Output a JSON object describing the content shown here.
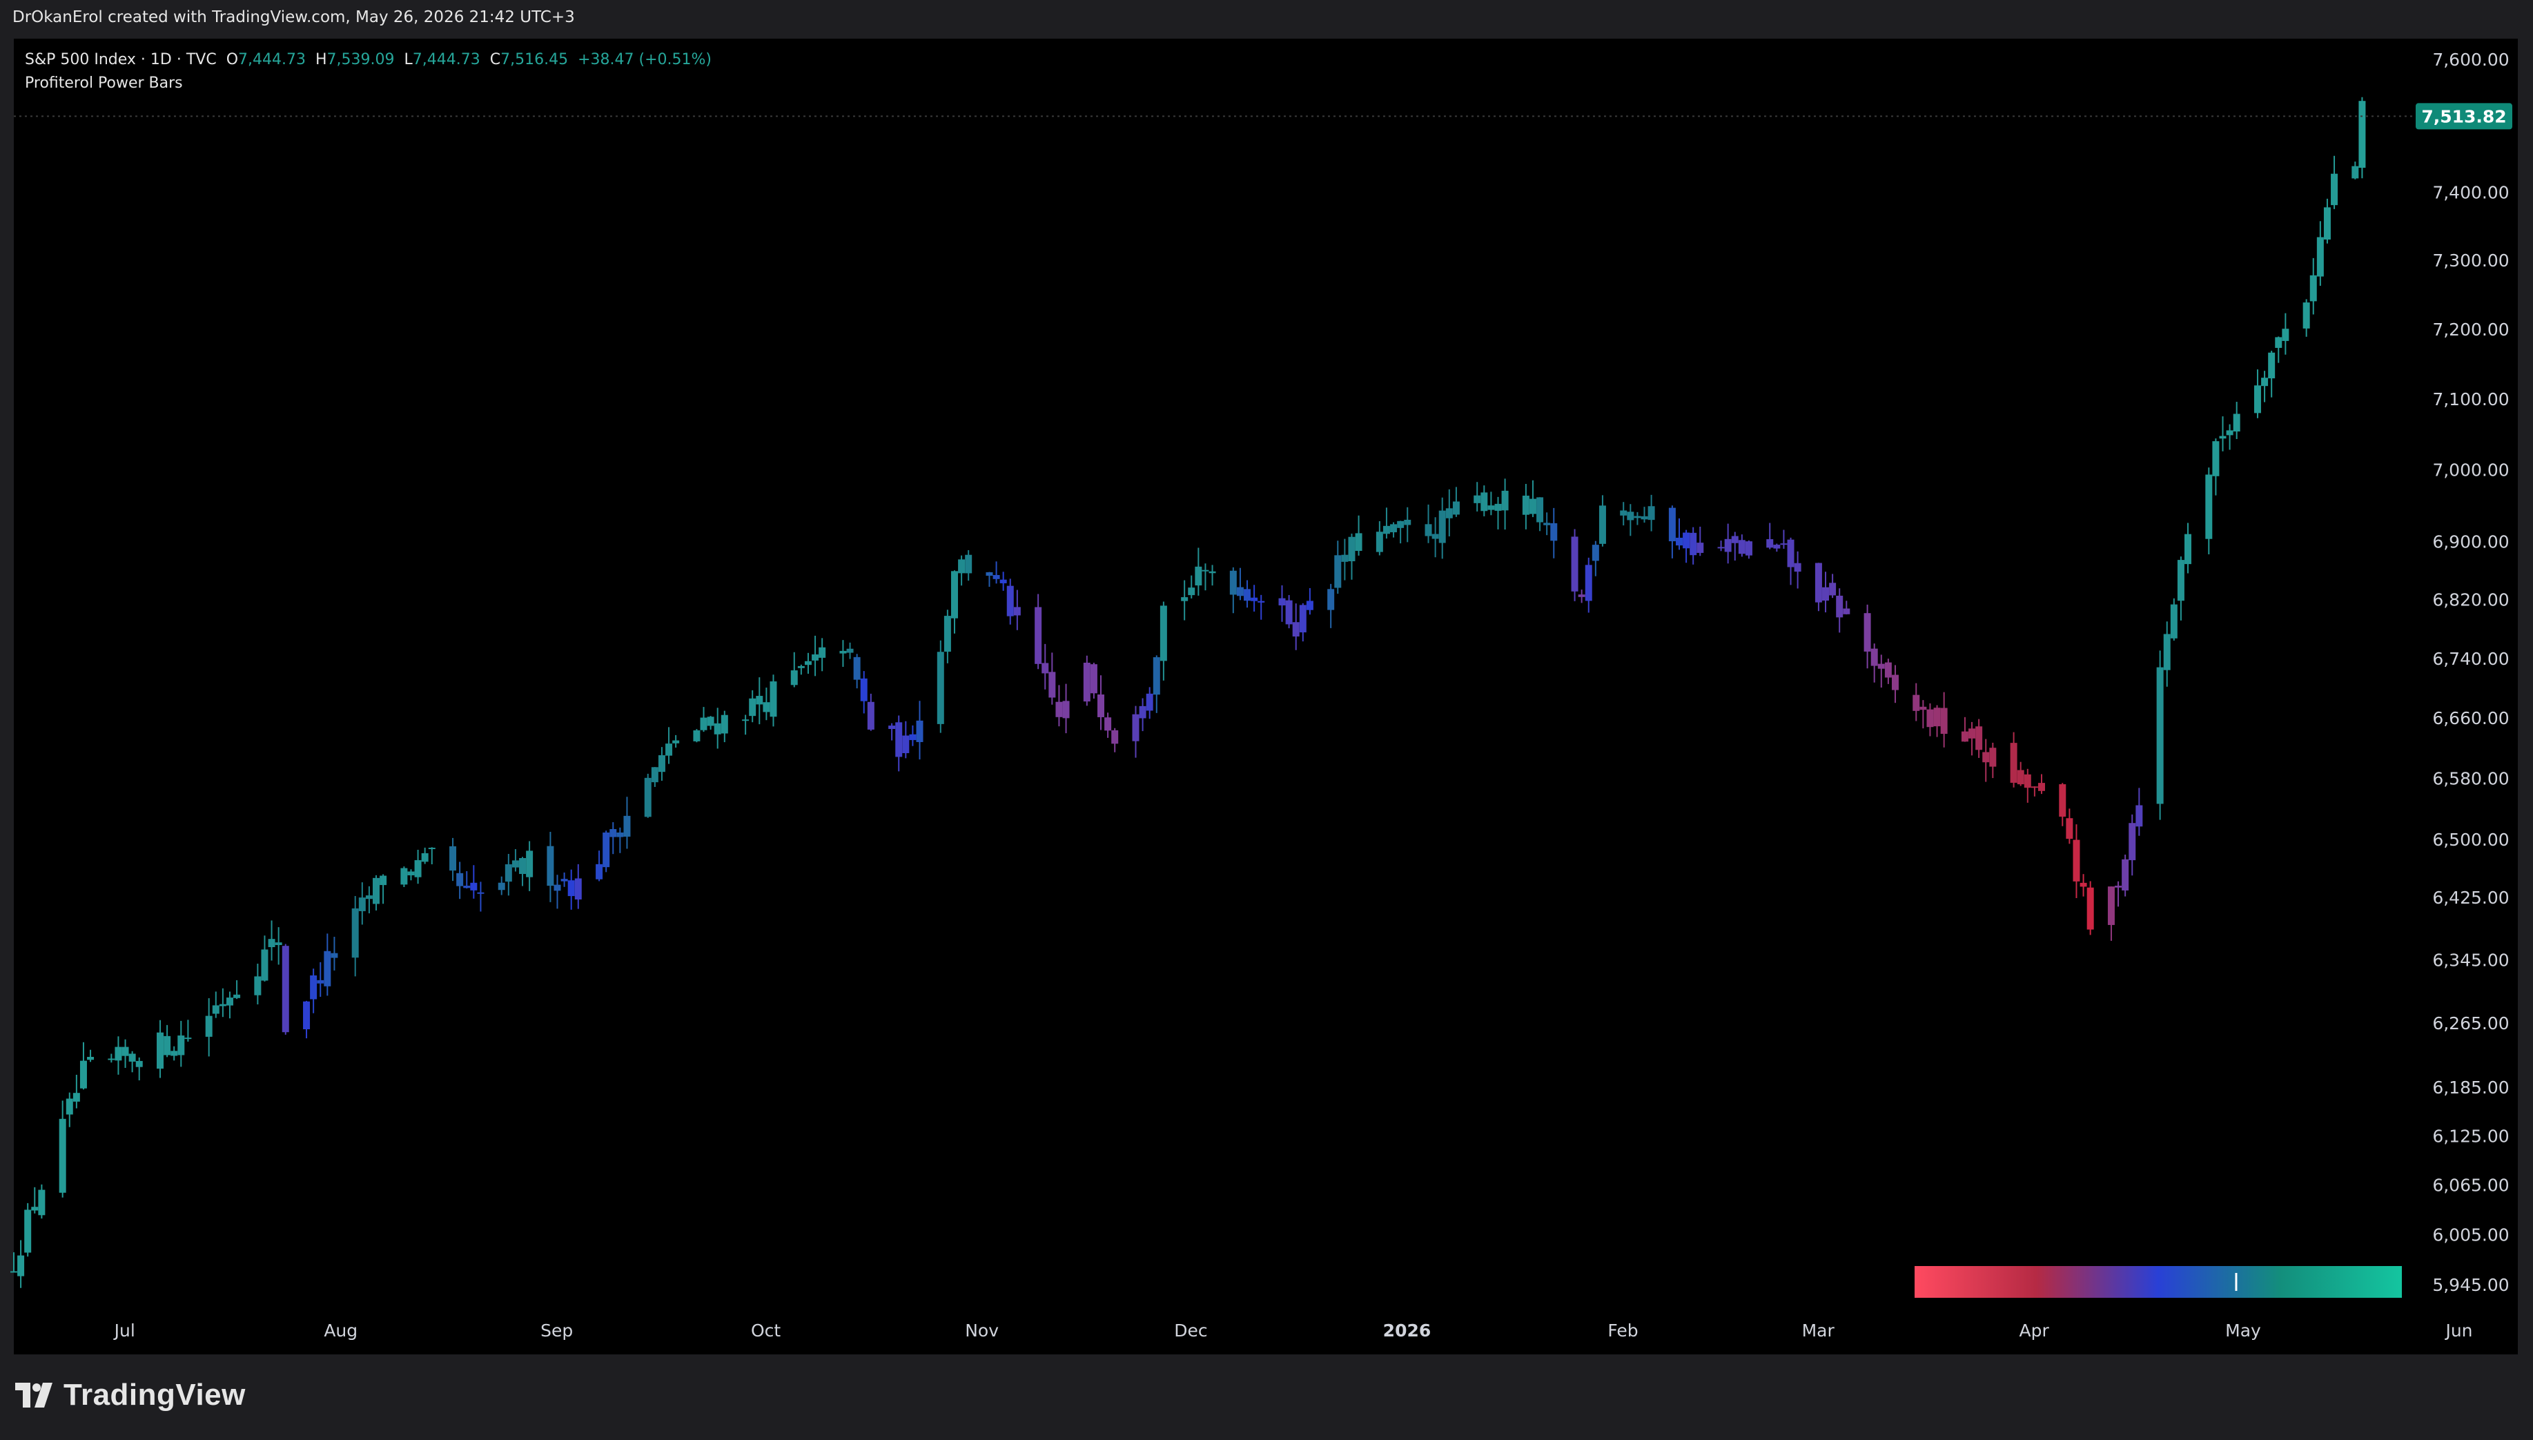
{
  "header": {
    "credit": "DrOkanErol created with TradingView.com, May 26, 2026 21:42 UTC+3"
  },
  "legend": {
    "symbol": "S&P 500 Index · 1D · TVC",
    "open_label": "O",
    "open": "7,444.73",
    "high_label": "H",
    "high": "7,539.09",
    "low_label": "L",
    "low": "7,444.73",
    "close_label": "C",
    "close": "7,516.45",
    "change": "+38.47 (+0.51%)",
    "indicator": "Profiterol Power Bars"
  },
  "footer": {
    "logo_text": "TradingView"
  },
  "colors": {
    "teal": "#26a69a",
    "bright_teal": "#14c5a0",
    "blue": "#2940d6",
    "purple": "#7b3fa0",
    "red": "#e2243f",
    "price_badge": "#0f8a78"
  },
  "chart_data": {
    "type": "candlestick",
    "axis_scale": "log",
    "y_ticks": [
      "7,600.00",
      "7,400.00",
      "7,300.00",
      "7,200.00",
      "7,100.00",
      "7,000.00",
      "6,900.00",
      "6,820.00",
      "6,740.00",
      "6,660.00",
      "6,580.00",
      "6,500.00",
      "6,425.00",
      "6,345.00",
      "6,265.00",
      "6,185.00",
      "6,125.00",
      "6,065.00",
      "6,005.00",
      "5,945.00"
    ],
    "x_ticks": [
      {
        "label": "Jul",
        "date": "2025-07-01",
        "bold": false
      },
      {
        "label": "Aug",
        "date": "2025-08-01",
        "bold": false
      },
      {
        "label": "Sep",
        "date": "2025-09-01",
        "bold": false
      },
      {
        "label": "Oct",
        "date": "2025-10-01",
        "bold": false
      },
      {
        "label": "Nov",
        "date": "2025-11-01",
        "bold": false
      },
      {
        "label": "Dec",
        "date": "2025-12-01",
        "bold": false
      },
      {
        "label": "2026",
        "date": "2026-01-01",
        "bold": true
      },
      {
        "label": "Feb",
        "date": "2026-02-01",
        "bold": false
      },
      {
        "label": "Mar",
        "date": "2026-03-01",
        "bold": false
      },
      {
        "label": "Apr",
        "date": "2026-04-01",
        "bold": false
      },
      {
        "label": "May",
        "date": "2026-05-01",
        "bold": false
      },
      {
        "label": "Jun",
        "date": "2026-06-01",
        "bold": false
      }
    ],
    "x_range": [
      "2025-06-23",
      "2026-06-01"
    ],
    "ylim": [
      5920,
      7680
    ],
    "last_price": 7513.82,
    "last_price_label": "7,513.82",
    "bar_color_key": {
      "t": "trend/power score 0-1: 0 = red (bearish), 0.5 = blue, 1 = teal (bullish)",
      "gradient": [
        "#ff4a60",
        "#b52a44",
        "#2940d6",
        "#138e7c",
        "#14c5a0"
      ],
      "marker_position": 0.66
    },
    "key_points": [
      {
        "date": "2025-06-23",
        "close": 5975,
        "t": 0.95
      },
      {
        "date": "2025-07-03",
        "close": 6200,
        "t": 0.95
      },
      {
        "date": "2025-07-18",
        "close": 6250,
        "t": 0.92
      },
      {
        "date": "2025-07-31",
        "close": 6370,
        "t": 0.9
      },
      {
        "date": "2025-08-01",
        "close": 6260,
        "t": 0.5
      },
      {
        "date": "2025-08-15",
        "close": 6450,
        "t": 0.92
      },
      {
        "date": "2025-08-22",
        "close": 6470,
        "t": 0.92
      },
      {
        "date": "2025-08-28",
        "close": 6420,
        "t": 0.6
      },
      {
        "date": "2025-09-05",
        "close": 6470,
        "t": 0.9
      },
      {
        "date": "2025-09-12",
        "close": 6440,
        "t": 0.55
      },
      {
        "date": "2025-09-26",
        "close": 6630,
        "t": 0.92
      },
      {
        "date": "2025-10-08",
        "close": 6680,
        "t": 0.92
      },
      {
        "date": "2025-10-20",
        "close": 6760,
        "t": 0.92
      },
      {
        "date": "2025-10-24",
        "close": 6650,
        "t": 0.5
      },
      {
        "date": "2025-10-29",
        "close": 6620,
        "t": 0.55
      },
      {
        "date": "2025-11-03",
        "close": 6750,
        "t": 0.85
      },
      {
        "date": "2025-11-05",
        "close": 6870,
        "t": 0.92
      },
      {
        "date": "2025-11-10",
        "close": 6860,
        "t": 0.7
      },
      {
        "date": "2025-11-14",
        "close": 6790,
        "t": 0.5
      },
      {
        "date": "2025-11-20",
        "close": 6660,
        "t": 0.4
      },
      {
        "date": "2025-11-24",
        "close": 6720,
        "t": 0.42
      },
      {
        "date": "2025-11-28",
        "close": 6640,
        "t": 0.38
      },
      {
        "date": "2025-12-03",
        "close": 6710,
        "t": 0.55
      },
      {
        "date": "2025-12-05",
        "close": 6810,
        "t": 0.9
      },
      {
        "date": "2025-12-12",
        "close": 6860,
        "t": 0.9
      },
      {
        "date": "2025-12-18",
        "close": 6830,
        "t": 0.6
      },
      {
        "date": "2025-12-24",
        "close": 6790,
        "t": 0.5
      },
      {
        "date": "2026-01-02",
        "close": 6900,
        "t": 0.9
      },
      {
        "date": "2026-01-13",
        "close": 6920,
        "t": 0.8
      },
      {
        "date": "2026-01-20",
        "close": 6960,
        "t": 0.9
      },
      {
        "date": "2026-01-27",
        "close": 6940,
        "t": 0.9
      },
      {
        "date": "2026-02-03",
        "close": 6820,
        "t": 0.42
      },
      {
        "date": "2026-02-06",
        "close": 6960,
        "t": 0.85
      },
      {
        "date": "2026-02-13",
        "close": 6930,
        "t": 0.8
      },
      {
        "date": "2026-02-20",
        "close": 6890,
        "t": 0.5
      },
      {
        "date": "2026-02-27",
        "close": 6890,
        "t": 0.5
      },
      {
        "date": "2026-03-04",
        "close": 6880,
        "t": 0.5
      },
      {
        "date": "2026-03-10",
        "close": 6820,
        "t": 0.48
      },
      {
        "date": "2026-03-13",
        "close": 6800,
        "t": 0.45
      },
      {
        "date": "2026-03-19",
        "close": 6700,
        "t": 0.35
      },
      {
        "date": "2026-03-25",
        "close": 6660,
        "t": 0.3
      },
      {
        "date": "2026-03-31",
        "close": 6630,
        "t": 0.25
      },
      {
        "date": "2026-04-06",
        "close": 6580,
        "t": 0.2
      },
      {
        "date": "2026-04-10",
        "close": 6560,
        "t": 0.18
      },
      {
        "date": "2026-04-14",
        "close": 6500,
        "t": 0.12
      },
      {
        "date": "2026-04-17",
        "close": 6380,
        "t": 0.08
      },
      {
        "date": "2026-04-21",
        "close": 6450,
        "t": 0.4
      },
      {
        "date": "2026-04-24",
        "close": 6560,
        "t": 0.5
      },
      {
        "date": "2026-04-27",
        "close": 6720,
        "t": 0.9
      },
      {
        "date": "2026-05-01",
        "close": 6920,
        "t": 0.93
      },
      {
        "date": "2026-05-06",
        "close": 7050,
        "t": 0.95
      },
      {
        "date": "2026-05-12",
        "close": 7150,
        "t": 0.95
      },
      {
        "date": "2026-05-18",
        "close": 7250,
        "t": 0.95
      },
      {
        "date": "2026-05-20",
        "close": 7330,
        "t": 0.95
      },
      {
        "date": "2026-05-22",
        "close": 7420,
        "t": 0.95
      },
      {
        "date": "2026-05-25",
        "close": 7440,
        "t": 0.93
      },
      {
        "date": "2026-05-26",
        "close": 7516,
        "t": 0.97
      }
    ]
  }
}
